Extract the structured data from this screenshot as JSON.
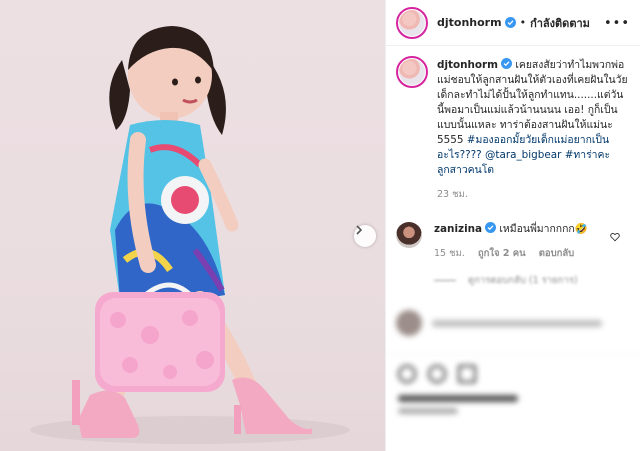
{
  "post": {
    "username": "djtonhorm",
    "follow_sep": "•",
    "follow_label": "กำลังติดตาม",
    "more_label": "•••"
  },
  "caption": {
    "username": "djtonhorm",
    "text": "เคยสงสัยว่าทำไมพวกพ่อแม่ชอบให้ลูกสานฝันให้ตัวเองที่เคยฝันในวัยเด็กละทำไม่ได้ปั้นให้ลูกทำแทน.......แต่วันนี้พอมาเป็นแม่แล้วน้านนนน เออ! กูก็เป็นแบบนั้นแหละ ทาร่าต้องสานฝันให้แม่นะ 5555",
    "hashtag_1": "#มองออกมั้ยวัยเด็กแม่อยากเป็นอะไร????",
    "mention": "@tara_bigbear",
    "hashtag_2": "#ทาร่าคะลูกสาวคนโต",
    "timestamp": "23 ชม."
  },
  "comment": {
    "username": "zanizina",
    "text": "เหมือนพี่มากกกก🤣",
    "timestamp": "15 ชม.",
    "likes": "ถูกใจ 2 คน",
    "reply_label": "ตอบกลับ",
    "view_replies": "ดูการตอบกลับ (1 รายการ)"
  },
  "icons": {
    "verified": "verified-badge-icon",
    "next": "chevron-right-icon",
    "heart": "heart-icon",
    "more": "more-icon"
  },
  "colors": {
    "verified": "#3897f0",
    "link": "#00376b",
    "muted": "#8e8e8e"
  }
}
